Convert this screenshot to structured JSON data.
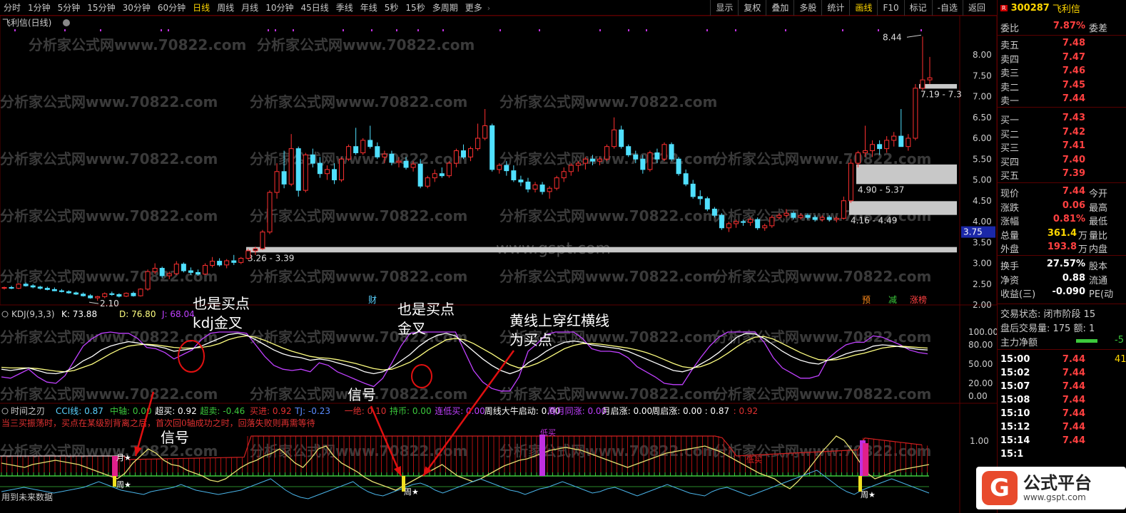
{
  "toolbar": {
    "period_tabs": [
      "分时",
      "1分钟",
      "5分钟",
      "15分钟",
      "30分钟",
      "60分钟",
      "日线",
      "周线",
      "月线",
      "10分钟",
      "45日线",
      "季线",
      "年线",
      "5秒",
      "15秒",
      "多周期",
      "更多"
    ],
    "active_tab": "日线",
    "right_tools": [
      "显示",
      "复权",
      "叠加",
      "多股",
      "统计",
      "画线",
      "F10",
      "标记",
      "-自选",
      "返回"
    ],
    "active_tool": "画线"
  },
  "stock": {
    "badge": "R",
    "code": "300287",
    "name": "飞利信"
  },
  "chart": {
    "title": "飞利信(日线)",
    "watermark_text": "分析家公式网www.70822.com",
    "center_watermark": "www.gspt.com",
    "price_axis": [
      "8.00",
      "7.50",
      "7.00",
      "6.50",
      "6.00",
      "5.50",
      "5.00",
      "4.50",
      "4.00",
      "3.50",
      "3.00",
      "2.50",
      "2.00"
    ],
    "high_label": "8.44",
    "low_label": "2.10",
    "current_price_tag": "3.75",
    "zones": [
      {
        "label": "3.26 - 3.39"
      },
      {
        "label": "4.16 - 4.49"
      },
      {
        "label": "4.90 - 5.37"
      },
      {
        "label": "7.19 - 7.3"
      }
    ],
    "event_markers": [
      "财",
      "预",
      "减",
      "涨榜"
    ],
    "candles": [
      [
        2.4,
        2.44,
        2.37,
        2.42
      ],
      [
        2.42,
        2.46,
        2.38,
        2.4
      ],
      [
        2.4,
        2.52,
        2.38,
        2.5
      ],
      [
        2.5,
        2.54,
        2.44,
        2.46
      ],
      [
        2.46,
        2.5,
        2.4,
        2.43
      ],
      [
        2.43,
        2.46,
        2.37,
        2.4
      ],
      [
        2.4,
        2.44,
        2.35,
        2.37
      ],
      [
        2.37,
        2.42,
        2.33,
        2.34
      ],
      [
        2.34,
        2.38,
        2.3,
        2.32
      ],
      [
        2.32,
        2.35,
        2.27,
        2.29
      ],
      [
        2.29,
        2.32,
        2.24,
        2.26
      ],
      [
        2.26,
        2.3,
        2.2,
        2.22
      ],
      [
        2.22,
        2.26,
        2.15,
        2.17
      ],
      [
        2.17,
        2.22,
        2.1,
        2.2
      ],
      [
        2.2,
        2.3,
        2.16,
        2.27
      ],
      [
        2.27,
        2.32,
        2.22,
        2.25
      ],
      [
        2.25,
        2.28,
        2.18,
        2.21
      ],
      [
        2.21,
        2.3,
        2.19,
        2.28
      ],
      [
        2.28,
        2.32,
        2.2,
        2.22
      ],
      [
        2.22,
        2.4,
        2.2,
        2.38
      ],
      [
        2.38,
        2.85,
        2.34,
        2.8
      ],
      [
        2.8,
        3.0,
        2.74,
        2.88
      ],
      [
        2.88,
        2.92,
        2.65,
        2.7
      ],
      [
        2.7,
        2.8,
        2.62,
        2.75
      ],
      [
        2.75,
        3.05,
        2.72,
        2.98
      ],
      [
        2.98,
        3.02,
        2.78,
        2.82
      ],
      [
        2.82,
        2.9,
        2.72,
        2.78
      ],
      [
        2.78,
        2.85,
        2.7,
        2.74
      ],
      [
        2.74,
        3.0,
        2.72,
        2.95
      ],
      [
        2.95,
        3.15,
        2.9,
        3.05
      ],
      [
        3.05,
        3.12,
        2.92,
        2.96
      ],
      [
        2.96,
        3.1,
        2.88,
        3.06
      ],
      [
        3.06,
        3.2,
        2.96,
        3.02
      ],
      [
        3.02,
        3.15,
        2.98,
        3.12
      ],
      [
        3.12,
        3.35,
        3.08,
        3.3
      ],
      [
        3.3,
        3.4,
        3.2,
        3.35
      ],
      [
        3.35,
        3.8,
        3.32,
        3.75
      ],
      [
        3.75,
        4.75,
        3.7,
        4.7
      ],
      [
        4.7,
        5.4,
        4.55,
        5.2
      ],
      [
        5.2,
        5.7,
        4.8,
        4.9
      ],
      [
        4.9,
        6.1,
        4.85,
        5.75
      ],
      [
        5.75,
        5.8,
        4.6,
        4.75
      ],
      [
        4.75,
        5.65,
        4.7,
        5.6
      ],
      [
        5.6,
        5.75,
        5.3,
        5.4
      ],
      [
        5.4,
        5.55,
        5.05,
        5.15
      ],
      [
        5.15,
        5.35,
        5.0,
        5.25
      ],
      [
        5.25,
        5.4,
        4.9,
        5.0
      ],
      [
        5.0,
        5.55,
        4.95,
        5.5
      ],
      [
        5.5,
        5.85,
        5.45,
        5.8
      ],
      [
        5.8,
        6.25,
        5.6,
        5.65
      ],
      [
        5.65,
        6.0,
        5.6,
        5.95
      ],
      [
        5.95,
        6.3,
        5.75,
        5.8
      ],
      [
        5.8,
        5.9,
        5.5,
        5.55
      ],
      [
        5.55,
        5.7,
        5.4,
        5.62
      ],
      [
        5.62,
        5.7,
        5.35,
        5.42
      ],
      [
        5.42,
        5.55,
        5.3,
        5.45
      ],
      [
        5.45,
        5.55,
        5.25,
        5.3
      ],
      [
        5.3,
        5.45,
        5.2,
        5.38
      ],
      [
        5.38,
        5.5,
        4.8,
        4.85
      ],
      [
        4.85,
        5.1,
        4.8,
        5.05
      ],
      [
        5.05,
        5.25,
        4.95,
        5.15
      ],
      [
        5.15,
        5.3,
        5.05,
        5.1
      ],
      [
        5.1,
        5.45,
        5.05,
        5.4
      ],
      [
        5.4,
        5.75,
        5.3,
        5.7
      ],
      [
        5.7,
        5.85,
        5.5,
        5.55
      ],
      [
        5.55,
        5.8,
        5.45,
        5.75
      ],
      [
        5.75,
        6.35,
        5.7,
        6.0
      ],
      [
        6.0,
        6.7,
        5.95,
        6.3
      ],
      [
        6.3,
        6.35,
        5.2,
        5.25
      ],
      [
        5.25,
        5.4,
        5.15,
        5.35
      ],
      [
        5.35,
        5.45,
        5.1,
        5.22
      ],
      [
        5.22,
        5.35,
        4.95,
        5.0
      ],
      [
        5.0,
        5.1,
        4.85,
        4.95
      ],
      [
        4.95,
        5.05,
        4.7,
        4.78
      ],
      [
        4.78,
        4.95,
        4.7,
        4.88
      ],
      [
        4.88,
        4.95,
        4.65,
        4.72
      ],
      [
        4.72,
        4.85,
        4.55,
        4.8
      ],
      [
        4.8,
        5.1,
        4.75,
        5.05
      ],
      [
        5.05,
        5.3,
        4.95,
        5.2
      ],
      [
        5.2,
        5.4,
        5.1,
        5.35
      ],
      [
        5.35,
        5.45,
        5.2,
        5.4
      ],
      [
        5.4,
        5.55,
        5.25,
        5.5
      ],
      [
        5.5,
        5.6,
        5.35,
        5.45
      ],
      [
        5.45,
        5.55,
        5.35,
        5.5
      ],
      [
        5.5,
        5.85,
        5.45,
        5.8
      ],
      [
        5.8,
        6.5,
        5.75,
        6.2
      ],
      [
        6.2,
        6.3,
        5.75,
        5.8
      ],
      [
        5.8,
        5.85,
        5.55,
        5.6
      ],
      [
        5.6,
        5.7,
        5.4,
        5.5
      ],
      [
        5.5,
        5.6,
        5.15,
        5.25
      ],
      [
        5.25,
        5.7,
        5.2,
        5.65
      ],
      [
        5.65,
        5.75,
        5.4,
        5.5
      ],
      [
        5.5,
        5.9,
        5.45,
        5.85
      ],
      [
        5.85,
        5.9,
        5.45,
        5.5
      ],
      [
        5.5,
        5.55,
        5.1,
        5.15
      ],
      [
        5.15,
        5.25,
        4.85,
        4.9
      ],
      [
        4.9,
        5.0,
        4.55,
        4.6
      ],
      [
        4.6,
        4.75,
        4.4,
        4.55
      ],
      [
        4.55,
        4.6,
        4.25,
        4.3
      ],
      [
        4.3,
        4.35,
        4.1,
        4.15
      ],
      [
        4.15,
        4.2,
        3.8,
        3.85
      ],
      [
        3.85,
        4.0,
        3.75,
        3.95
      ],
      [
        3.95,
        4.05,
        3.85,
        4.0
      ],
      [
        4.0,
        4.05,
        3.9,
        3.98
      ],
      [
        3.98,
        4.1,
        3.9,
        4.05
      ],
      [
        4.05,
        4.1,
        3.8,
        3.85
      ],
      [
        3.85,
        3.95,
        3.78,
        3.9
      ],
      [
        3.9,
        4.15,
        3.85,
        4.1
      ],
      [
        4.1,
        4.2,
        4.05,
        4.15
      ],
      [
        4.15,
        4.3,
        4.1,
        4.2
      ],
      [
        4.2,
        4.25,
        4.05,
        4.1
      ],
      [
        4.1,
        4.2,
        4.05,
        4.15
      ],
      [
        4.15,
        4.2,
        4.05,
        4.1
      ],
      [
        4.1,
        4.15,
        4.0,
        4.05
      ],
      [
        4.05,
        4.15,
        4.0,
        4.1
      ],
      [
        4.1,
        4.15,
        4.0,
        4.05
      ],
      [
        4.05,
        4.12,
        3.98,
        4.08
      ],
      [
        4.08,
        4.6,
        4.05,
        4.5
      ],
      [
        4.5,
        5.5,
        4.45,
        5.4
      ],
      [
        5.4,
        5.7,
        5.3,
        5.65
      ],
      [
        5.65,
        6.3,
        5.55,
        5.7
      ],
      [
        5.7,
        5.95,
        5.55,
        5.85
      ],
      [
        5.85,
        5.95,
        5.6,
        5.75
      ],
      [
        5.75,
        6.05,
        5.65,
        5.95
      ],
      [
        5.95,
        6.15,
        5.8,
        6.05
      ],
      [
        6.05,
        6.7,
        5.95,
        5.8
      ],
      [
        5.8,
        6.1,
        5.7,
        6.0
      ],
      [
        6.0,
        7.3,
        5.95,
        7.2
      ],
      [
        7.2,
        8.44,
        7.15,
        7.4
      ],
      [
        7.4,
        7.95,
        7.3,
        7.45
      ]
    ]
  },
  "kdj": {
    "label": "KDJ(9,3,3)",
    "k_label": "K: 73.88",
    "d_label": "D: 76.80",
    "j_label": "J: 68.04",
    "axis": [
      "100.00",
      "80.00",
      "50.00",
      "20.00",
      "0.00"
    ],
    "k": [
      42,
      40,
      42,
      44,
      40,
      36,
      35,
      38,
      45,
      55,
      62,
      72,
      78,
      82,
      85,
      83,
      80,
      78,
      75,
      70,
      72,
      74,
      78,
      84,
      90,
      96,
      98,
      95,
      88,
      80,
      72,
      66,
      62,
      60,
      56,
      58,
      56,
      52,
      48,
      44,
      38,
      35,
      38,
      45,
      55,
      65,
      78,
      88,
      95,
      98,
      94,
      82,
      70,
      58,
      48,
      40,
      35,
      40,
      52,
      60,
      70,
      78,
      84,
      86,
      84,
      80,
      78,
      76,
      74,
      70,
      64,
      58,
      52,
      46,
      40,
      38,
      42,
      50,
      58,
      68,
      80,
      92,
      98,
      97,
      90,
      80,
      70,
      62,
      56,
      52,
      50,
      56,
      60,
      66,
      70,
      72,
      78,
      80,
      79,
      77,
      75,
      73,
      72
    ],
    "d": [
      45,
      44,
      44,
      44,
      43,
      41,
      39,
      38,
      40,
      45,
      50,
      58,
      66,
      73,
      78,
      80,
      81,
      80,
      78,
      76,
      75,
      75,
      76,
      78,
      82,
      88,
      92,
      94,
      92,
      87,
      81,
      75,
      70,
      66,
      62,
      60,
      59,
      57,
      54,
      51,
      47,
      43,
      41,
      42,
      47,
      53,
      62,
      72,
      80,
      88,
      90,
      88,
      82,
      74,
      66,
      57,
      49,
      44,
      46,
      51,
      58,
      66,
      74,
      79,
      82,
      82,
      81,
      79,
      77,
      75,
      72,
      68,
      63,
      57,
      51,
      46,
      44,
      46,
      51,
      58,
      67,
      77,
      86,
      92,
      93,
      89,
      82,
      75,
      68,
      62,
      57,
      56,
      57,
      60,
      64,
      67,
      71,
      75,
      77,
      78,
      77,
      76,
      75
    ],
    "j": [
      30,
      28,
      35,
      42,
      30,
      22,
      20,
      32,
      55,
      78,
      90,
      98,
      100,
      98,
      98,
      90,
      76,
      74,
      68,
      58,
      65,
      72,
      88,
      98,
      100,
      100,
      100,
      98,
      80,
      62,
      48,
      42,
      40,
      42,
      38,
      52,
      48,
      38,
      32,
      26,
      20,
      15,
      28,
      52,
      78,
      98,
      100,
      100,
      100,
      100,
      100,
      70,
      40,
      22,
      12,
      8,
      8,
      30,
      70,
      82,
      96,
      100,
      100,
      100,
      90,
      74,
      70,
      70,
      68,
      60,
      46,
      38,
      30,
      20,
      18,
      18,
      40,
      60,
      78,
      92,
      100,
      100,
      100,
      100,
      84,
      60,
      44,
      36,
      28,
      28,
      32,
      58,
      70,
      80,
      84,
      84,
      94,
      92,
      86,
      80,
      72,
      68,
      66
    ]
  },
  "indicator": {
    "title": "时间之刃",
    "legend": [
      {
        "text": "CCI线: 0.87",
        "color": "#5ad2ff"
      },
      {
        "text": "中轴: 0.00",
        "color": "#3cc83c"
      },
      {
        "text": "超买: 0.92",
        "color": "#ffffff"
      },
      {
        "text": "超卖: -0.46",
        "color": "#3cc83c"
      },
      {
        "text": "买进: 0.92",
        "color": "#e03030"
      },
      {
        "text": "TJ: -0.23",
        "color": "#5a8cff"
      },
      {
        "text": "一绝: 0.10",
        "color": "#e03030"
      },
      {
        "text": "持币: 0.00",
        "color": "#3cc83c"
      },
      {
        "text": "连低买: 0.00",
        "color": "#c040ff"
      },
      {
        "text": "周线大牛启动: 0.00",
        "color": "#ffffff"
      },
      {
        "text": "周月同涨: 0.00",
        "color": "#c040ff"
      },
      {
        "text": "月启涨: 0.00",
        "color": "#ffffff"
      },
      {
        "text": "周启涨: 0.00 : 0.87",
        "color": "#ffffff"
      },
      {
        "text": ": 0.92",
        "color": "#e03030"
      }
    ],
    "note": "当三买振荡时，买点在某级别背离之后，首次回0轴成功之时，回落失败则再需等待",
    "axis": [
      "1.00"
    ],
    "star_labels": [
      "月★",
      "周★",
      "周★",
      "周★"
    ],
    "low_buy_labels": [
      "低买",
      "低买"
    ],
    "future_note": "用到未来数据"
  },
  "annotations": {
    "kdj_cross_1": "也是买点\nkdj金叉",
    "kdj_cross_2": "也是买点\n金叉",
    "yellow_line": "黄线上穿红横线\n为买点",
    "signal_1": "信号",
    "signal_2": "信号"
  },
  "quote": {
    "weibi_label": "委比",
    "weibi_value": "7.87%",
    "weicha_label": "委差",
    "asks": [
      {
        "label": "卖五",
        "price": "7.48"
      },
      {
        "label": "卖四",
        "price": "7.47"
      },
      {
        "label": "卖三",
        "price": "7.46"
      },
      {
        "label": "卖二",
        "price": "7.45"
      },
      {
        "label": "卖一",
        "price": "7.44"
      }
    ],
    "bids": [
      {
        "label": "买一",
        "price": "7.43"
      },
      {
        "label": "买二",
        "price": "7.42"
      },
      {
        "label": "买三",
        "price": "7.41"
      },
      {
        "label": "买四",
        "price": "7.40"
      },
      {
        "label": "买五",
        "price": "7.39"
      }
    ],
    "stats": [
      {
        "label": "现价",
        "value": "7.44",
        "right": "今开",
        "color": "#ff4040"
      },
      {
        "label": "涨跌",
        "value": "0.06",
        "right": "最高",
        "color": "#ff4040"
      },
      {
        "label": "涨幅",
        "value": "0.81%",
        "right": "最低",
        "color": "#ff4040"
      },
      {
        "label": "总量",
        "value": "361.4",
        "unit": "万",
        "right": "量比",
        "color": "#ffd700"
      },
      {
        "label": "外盘",
        "value": "193.8",
        "unit": "万",
        "right": "内盘",
        "color": "#ff4040"
      },
      {
        "label": "换手",
        "value": "27.57%",
        "right": "股本",
        "color": "#ffffff"
      },
      {
        "label": "净资",
        "value": "0.88",
        "right": "流通",
        "color": "#ffffff"
      },
      {
        "label": "收益(三)",
        "value": "-0.090",
        "right": "PE(动",
        "color": "#ffffff"
      }
    ],
    "trade_status": "交易状态: 闭市阶段 15",
    "after_hours": "盘后交易量: 175  额: 1",
    "main_net": "主力净额",
    "main_net_value": "-5",
    "ticks": [
      {
        "time": "15:00",
        "price": "7.44",
        "vol": "41"
      },
      {
        "time": "15:02",
        "price": "7.44",
        "vol": ""
      },
      {
        "time": "15:07",
        "price": "7.44",
        "vol": ""
      },
      {
        "time": "15:08",
        "price": "7.44",
        "vol": ""
      },
      {
        "time": "15:10",
        "price": "7.44",
        "vol": ""
      },
      {
        "time": "15:12",
        "price": "7.44",
        "vol": ""
      },
      {
        "time": "15:14",
        "price": "7.44",
        "vol": ""
      },
      {
        "time": "15:1",
        "price": "",
        "vol": ""
      }
    ]
  },
  "logo": {
    "name": "公式平台",
    "url": "www.gspt.com"
  },
  "colors": {
    "up": "#ff3030",
    "down": "#50e0ff",
    "zone": "#c8c8c8",
    "k_line": "#ffffff",
    "d_line": "#ffff80",
    "j_line": "#c040ff",
    "frame": "#5a0000",
    "annotation": "#e01010"
  }
}
